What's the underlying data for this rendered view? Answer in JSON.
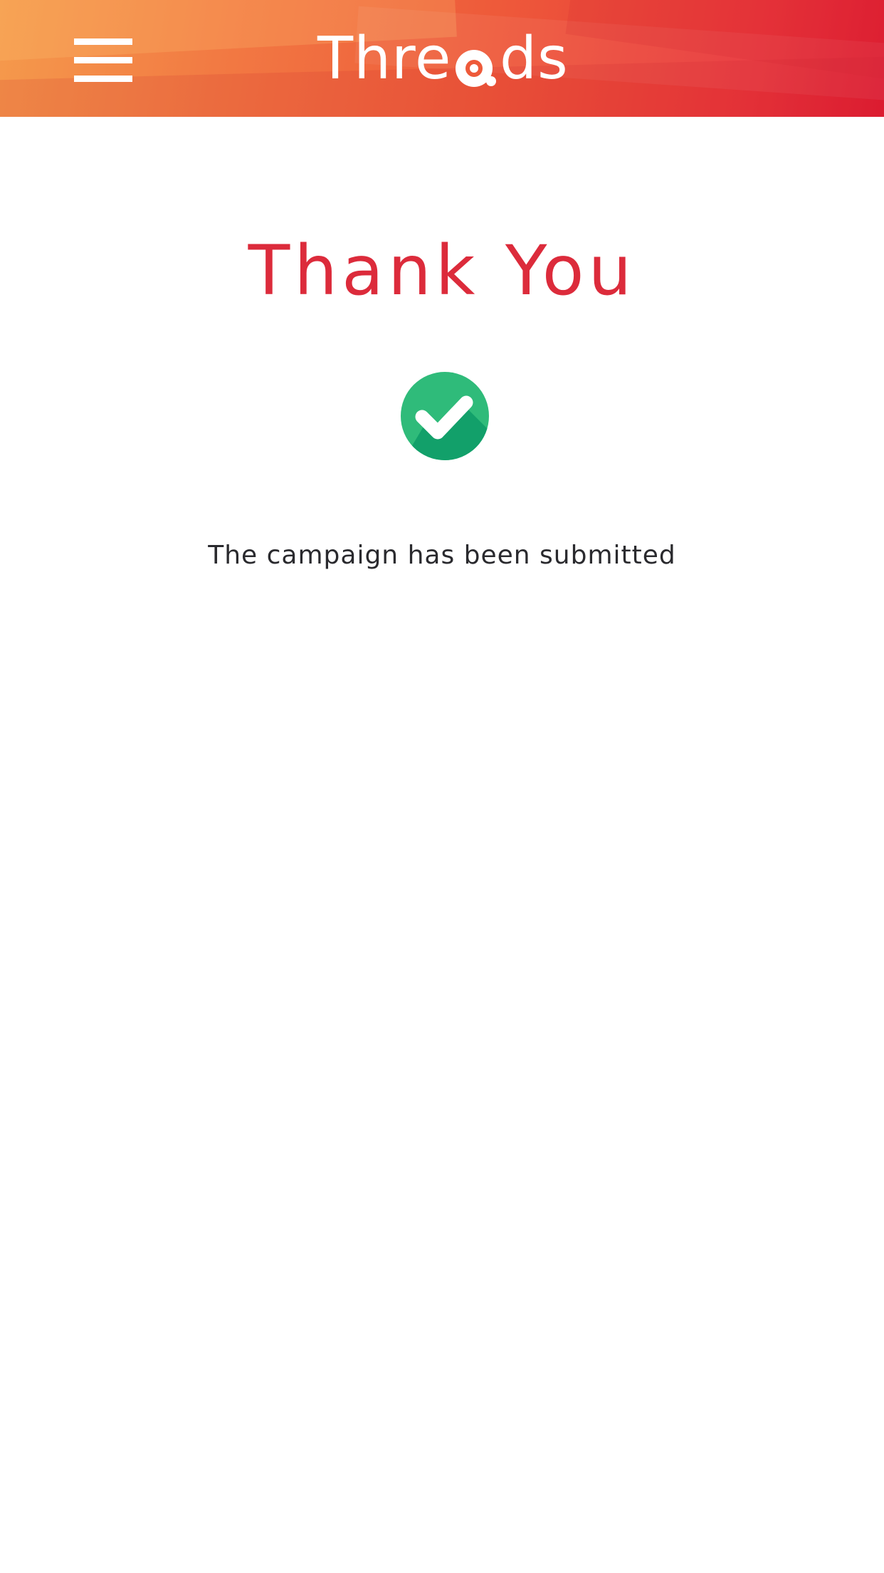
{
  "header": {
    "menu_icon": "hamburger-menu-icon",
    "logo_text": "Threads",
    "logo_parts": {
      "before": "Thre",
      "after": "ds"
    },
    "logo_a_icon": "at-sign-icon",
    "gradient_colors": [
      "#f59a4c",
      "#ee5a3a",
      "#df1c32"
    ]
  },
  "main": {
    "title": "Thank You",
    "title_color": "#dc2b3b",
    "status_icon": "check-circle-icon",
    "status_icon_color": "#2fbb7a",
    "message": "The campaign has been submitted"
  }
}
